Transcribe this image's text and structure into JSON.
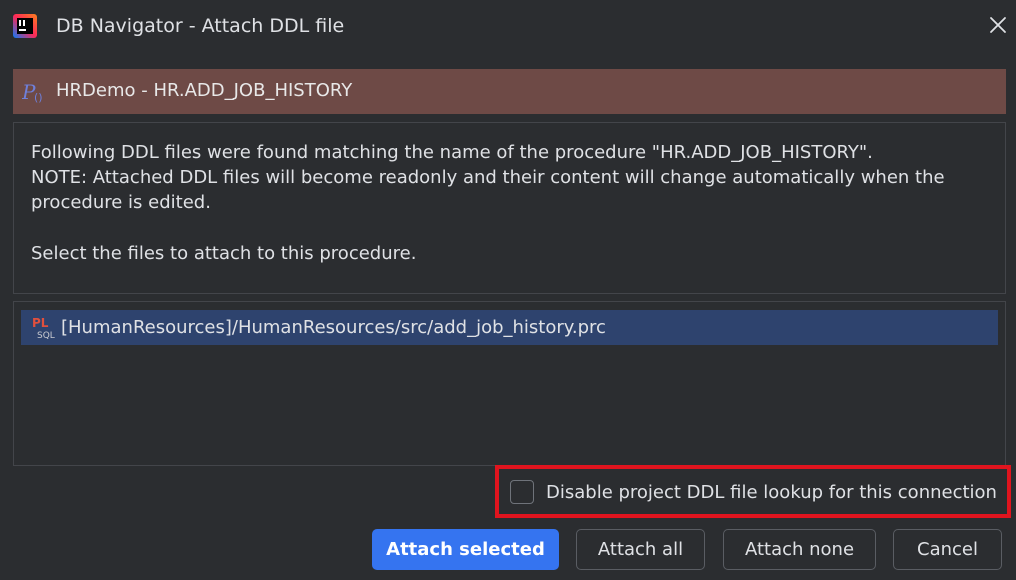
{
  "window": {
    "title": "DB Navigator - Attach DDL file",
    "app_icon": "intellij-logo-icon",
    "close_icon": "close-icon"
  },
  "object_header": {
    "icon": "procedure-icon",
    "title": "HRDemo - HR.ADD_JOB_HISTORY",
    "background": "#6e4a46"
  },
  "info": {
    "lines": [
      "Following DDL files were found matching the name of the procedure \"HR.ADD_JOB_HISTORY\".",
      "NOTE: Attached DDL files will become readonly and their content will change automatically when the",
      "procedure is edited.",
      "Select the files to attach to this procedure."
    ]
  },
  "file_list": {
    "items": [
      {
        "icon": "plsql-file-icon",
        "icon_text_top": "PL",
        "icon_text_bottom": "SQL",
        "path": "[HumanResources]/HumanResources/src/add_job_history.prc",
        "selected": true
      }
    ],
    "selection_color": "#2e436e"
  },
  "options": {
    "disable_lookup_label": "Disable project DDL file lookup for this connection",
    "disable_lookup_checked": false,
    "highlight_color": "#e0141e"
  },
  "buttons": {
    "attach_selected": "Attach selected",
    "attach_all": "Attach all",
    "attach_none": "Attach none",
    "cancel": "Cancel"
  },
  "colors": {
    "background": "#2b2d30",
    "primary": "#3574f0",
    "text": "#dfe1e5"
  }
}
